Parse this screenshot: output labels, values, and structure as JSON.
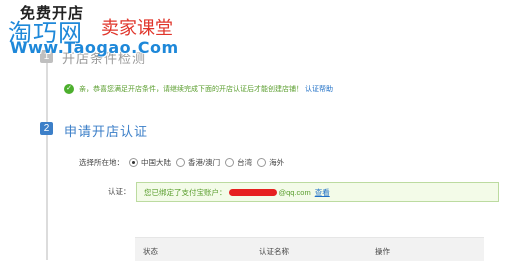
{
  "page_title": "免费开店",
  "watermark": {
    "main": "淘巧网",
    "sub": "卖家课堂",
    "url": "Www.Taogao.Com"
  },
  "steps": [
    {
      "number": "1",
      "title": "开店条件检测"
    },
    {
      "number": "2",
      "title": "申请开店认证"
    }
  ],
  "success_message": {
    "text": "亲，恭喜您满足开店条件，请继续完成下面的开店认证后才能创建店铺！",
    "link": "认证帮助"
  },
  "region": {
    "label": "选择所在地：",
    "options": [
      "中国大陆",
      "香港/澳门",
      "台湾",
      "海外"
    ],
    "selected": "中国大陆"
  },
  "certification": {
    "label": "认证：",
    "bound_text": "您已绑定了支付宝账户：",
    "email_suffix": "@qq.com",
    "view_link": "查看"
  },
  "table": {
    "headers": [
      "状态",
      "认证名称",
      "操作"
    ]
  },
  "colors": {
    "accent": "#3c7fc8",
    "success": "#5a9e2e",
    "link": "#1e6fc6",
    "watermark_blue": "#1e88d9",
    "watermark_red": "#e0352b"
  }
}
